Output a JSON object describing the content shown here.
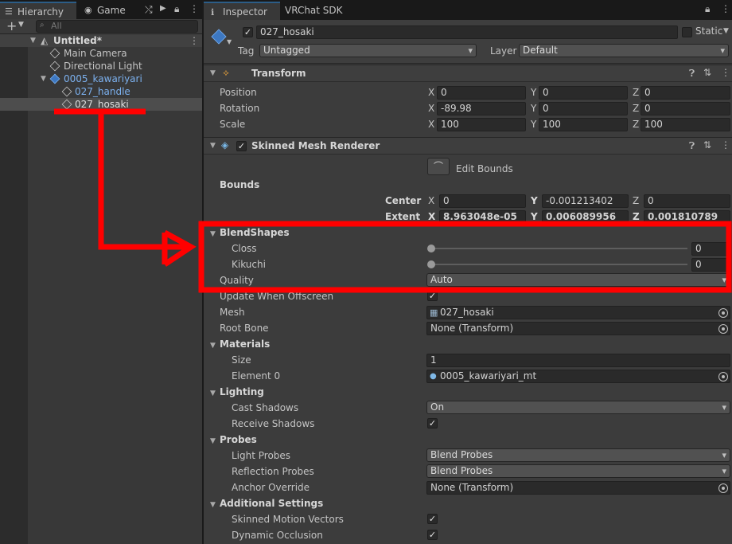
{
  "hierarchy": {
    "tabs": [
      {
        "label": "Hierarchy",
        "icon": "list-icon"
      },
      {
        "label": "Game",
        "icon": "gamepad-icon"
      }
    ],
    "search_placeholder": "All",
    "tree": [
      {
        "label": "Untitled*",
        "icon": "unity-icon",
        "level": 0
      },
      {
        "label": "Main Camera",
        "icon": "cube-icon",
        "level": 1
      },
      {
        "label": "Directional Light",
        "icon": "cube-icon",
        "level": 1
      },
      {
        "label": "0005_kawariyari",
        "icon": "prefab-icon",
        "level": 1
      },
      {
        "label": "027_handle",
        "icon": "cube-icon",
        "level": 2
      },
      {
        "label": "027_hosaki",
        "icon": "cube-icon",
        "level": 2
      }
    ]
  },
  "inspector": {
    "tabs": [
      "Inspector",
      "VRChat SDK"
    ],
    "object_name": "027_hosaki",
    "static_label": "Static",
    "tag_label": "Tag",
    "tag_value": "Untagged",
    "layer_label": "Layer",
    "layer_value": "Default",
    "transform": {
      "title": "Transform",
      "rows": [
        {
          "label": "Position",
          "x": "0",
          "y": "0",
          "z": "0"
        },
        {
          "label": "Rotation",
          "x": "-89.98",
          "y": "0",
          "z": "0"
        },
        {
          "label": "Scale",
          "x": "100",
          "y": "100",
          "z": "100"
        }
      ]
    },
    "smr": {
      "title": "Skinned Mesh Renderer",
      "edit_bounds": "Edit Bounds",
      "bounds_label": "Bounds",
      "center_label": "Center",
      "extent_label": "Extent",
      "center": {
        "x": "0",
        "y": "-0.001213402",
        "z": "0"
      },
      "extent": {
        "x": "8.963048e-05",
        "y": "0.006089956",
        "z": "0.001810789"
      },
      "blendshapes_label": "BlendShapes",
      "blendshapes": [
        {
          "label": "Closs",
          "value": "0"
        },
        {
          "label": "Kikuchi",
          "value": "0"
        }
      ],
      "quality_label": "Quality",
      "quality_value": "Auto",
      "update_offscreen_label": "Update When Offscreen",
      "mesh_label": "Mesh",
      "mesh_value": "027_hosaki",
      "root_bone_label": "Root Bone",
      "root_bone_value": "None (Transform)",
      "materials_label": "Materials",
      "size_label": "Size",
      "size_value": "1",
      "element0_label": "Element 0",
      "element0_value": "0005_kawariyari_mt",
      "lighting_label": "Lighting",
      "cast_shadows_label": "Cast Shadows",
      "cast_shadows_value": "On",
      "receive_shadows_label": "Receive Shadows",
      "probes_label": "Probes",
      "light_probes_label": "Light Probes",
      "light_probes_value": "Blend Probes",
      "reflection_probes_label": "Reflection Probes",
      "reflection_probes_value": "Blend Probes",
      "anchor_override_label": "Anchor Override",
      "anchor_override_value": "None (Transform)",
      "additional_label": "Additional Settings",
      "motion_vectors_label": "Skinned Motion Vectors",
      "dynamic_occlusion_label": "Dynamic Occlusion"
    }
  },
  "colors": {
    "annotation": "#ff0000",
    "selection": "#4d4d4d",
    "accent": "#2c5d87"
  }
}
